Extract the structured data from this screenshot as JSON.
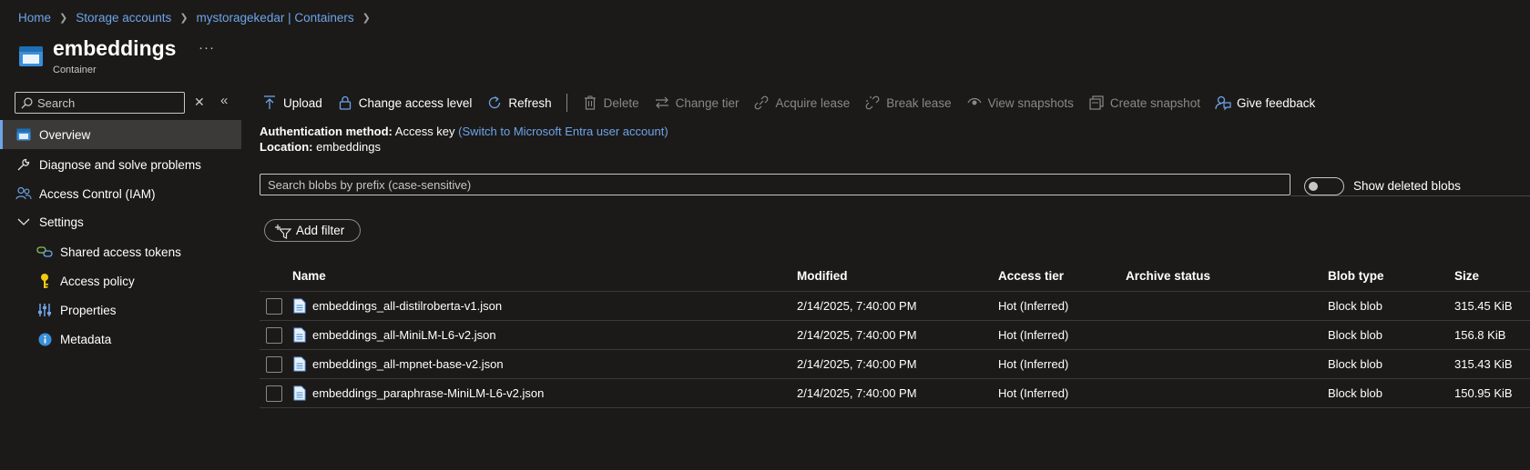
{
  "breadcrumb": [
    "Home",
    "Storage accounts",
    "mystoragekedar | Containers"
  ],
  "header": {
    "title": "embeddings",
    "subtitle": "Container",
    "more": "···"
  },
  "sidebar": {
    "search_placeholder": "Search",
    "items": [
      {
        "label": "Overview",
        "icon": "container-icon",
        "active": true
      },
      {
        "label": "Diagnose and solve problems",
        "icon": "wrench-icon"
      },
      {
        "label": "Access Control (IAM)",
        "icon": "people-icon"
      },
      {
        "label": "Settings",
        "icon": "chevron-down-icon"
      },
      {
        "label": "Shared access tokens",
        "icon": "link-icon"
      },
      {
        "label": "Access policy",
        "icon": "key-icon"
      },
      {
        "label": "Properties",
        "icon": "sliders-icon"
      },
      {
        "label": "Metadata",
        "icon": "info-icon"
      }
    ]
  },
  "toolbar": {
    "upload": "Upload",
    "change_access_level": "Change access level",
    "refresh": "Refresh",
    "delete": "Delete",
    "change_tier": "Change tier",
    "acquire_lease": "Acquire lease",
    "break_lease": "Break lease",
    "view_snapshots": "View snapshots",
    "create_snapshot": "Create snapshot",
    "give_feedback": "Give feedback"
  },
  "info": {
    "auth_label": "Authentication method:",
    "auth_value": "Access key",
    "auth_link": "(Switch to Microsoft Entra user account)",
    "location_label": "Location:",
    "location_value": "embeddings"
  },
  "search": {
    "placeholder": "Search blobs by prefix (case-sensitive)"
  },
  "toggle_label": "Show deleted blobs",
  "add_filter": "Add filter",
  "table": {
    "headers": {
      "name": "Name",
      "modified": "Modified",
      "access_tier": "Access tier",
      "archive_status": "Archive status",
      "blob_type": "Blob type",
      "size": "Size"
    },
    "rows": [
      {
        "name": "embeddings_all-distilroberta-v1.json",
        "modified": "2/14/2025, 7:40:00 PM",
        "access_tier": "Hot (Inferred)",
        "archive_status": "",
        "blob_type": "Block blob",
        "size": "315.45 KiB"
      },
      {
        "name": "embeddings_all-MiniLM-L6-v2.json",
        "modified": "2/14/2025, 7:40:00 PM",
        "access_tier": "Hot (Inferred)",
        "archive_status": "",
        "blob_type": "Block blob",
        "size": "156.8 KiB"
      },
      {
        "name": "embeddings_all-mpnet-base-v2.json",
        "modified": "2/14/2025, 7:40:00 PM",
        "access_tier": "Hot (Inferred)",
        "archive_status": "",
        "blob_type": "Block blob",
        "size": "315.43 KiB"
      },
      {
        "name": "embeddings_paraphrase-MiniLM-L6-v2.json",
        "modified": "2/14/2025, 7:40:00 PM",
        "access_tier": "Hot (Inferred)",
        "archive_status": "",
        "blob_type": "Block blob",
        "size": "150.95 KiB"
      }
    ]
  },
  "colors": {
    "accent": "#6ea4e8",
    "background": "#1b1a19",
    "active_nav": "#3b3a39"
  }
}
